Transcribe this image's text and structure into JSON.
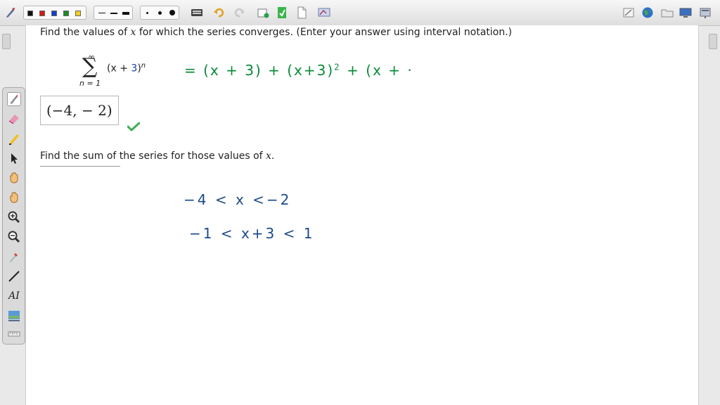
{
  "question": {
    "prompt_start": "Find the values of ",
    "prompt_var": "x",
    "prompt_end": " for which the series converges. (Enter your answer using interval notation.)",
    "series": {
      "sum_top": "∞",
      "sum_bottom": "n = 1",
      "term_open": "(x + ",
      "term_const": "3",
      "term_close": ")",
      "term_exp": "n"
    },
    "answer": "(−4, − 2)",
    "sum_prompt_start": "Find the sum of the series for those values of ",
    "sum_prompt_var": "x",
    "sum_prompt_end": "."
  },
  "handwriting": {
    "line1": "=   (x + 3)  + (x+3)",
    "line1_sup": "2",
    "line1_tail": "+ (x + ·",
    "line2": "−4 < x  <−2",
    "line3": "−1 < x+3 < 1"
  },
  "toolbar": {
    "colors": [
      "#111111",
      "#d11a1a",
      "#1440c8",
      "#1a8a2a",
      "#f0d020"
    ],
    "right_icons": [
      "page-icon",
      "globe-icon",
      "folder-icon",
      "screen-icon",
      "settings-icon"
    ]
  },
  "palette": {
    "tools": [
      "pen-icon",
      "eraser-icon",
      "highlighter-icon",
      "select-icon",
      "hand-icon",
      "pan-icon",
      "zoom-in-icon",
      "zoom-out-icon",
      "dropper-icon",
      "line-icon",
      "text-icon",
      "image-icon",
      "ruler-icon"
    ],
    "text_tool_label": "A"
  },
  "accent": "#0a8a3a",
  "ink_blue": "#1c4a8c"
}
